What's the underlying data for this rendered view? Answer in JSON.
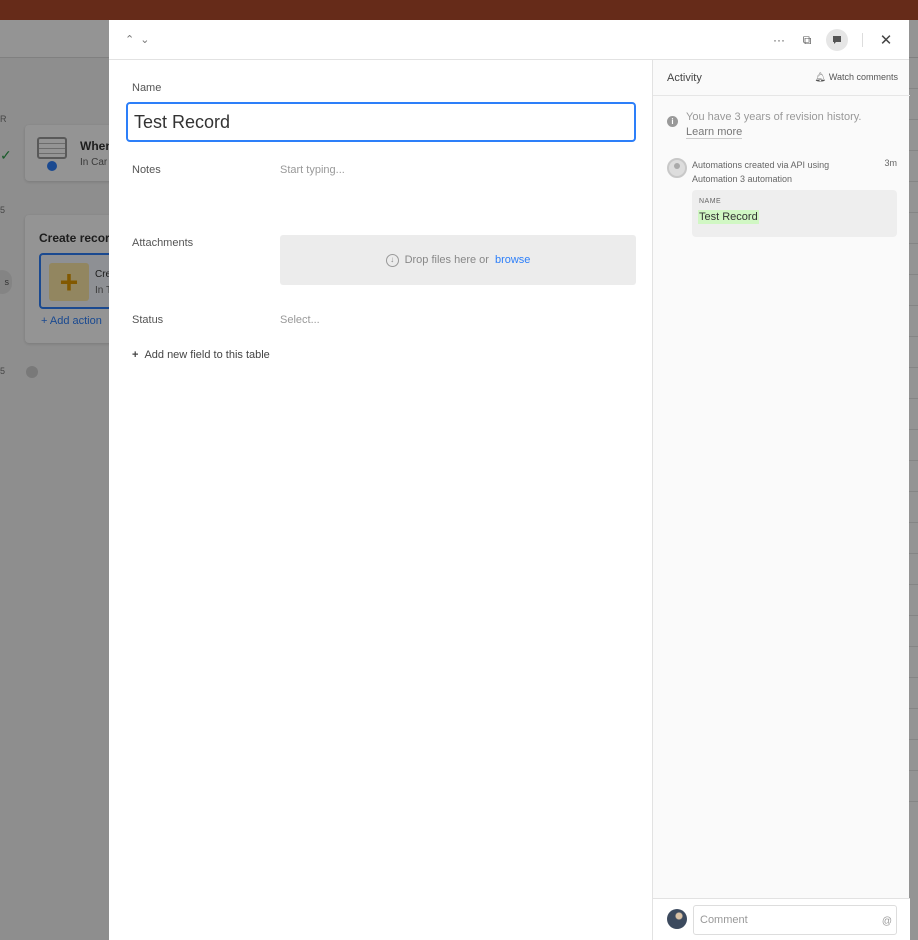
{
  "background": {
    "trigger_card": {
      "title": "When",
      "subtitle": "In Car"
    },
    "action_card": {
      "title": "Create record",
      "inner_title": "Cre",
      "inner_subtitle": "In T",
      "add_action": "Add action"
    },
    "side_badge": "s"
  },
  "header": {
    "prev_icon": "chevron-up-icon",
    "next_icon": "chevron-down-icon",
    "more_icon": "more-horizontal-icon",
    "expand_icon": "expand-icon",
    "comment_icon": "comment-icon",
    "close_icon": "close-icon"
  },
  "record": {
    "name_label": "Name",
    "name_value": "Test Record",
    "notes_label": "Notes",
    "notes_placeholder": "Start typing...",
    "attachments_label": "Attachments",
    "drop_text": "Drop files here or",
    "browse_text": "browse",
    "status_label": "Status",
    "status_placeholder": "Select...",
    "add_field_text": "Add new field to this table"
  },
  "activity": {
    "title": "Activity",
    "watch_label": "Watch comments",
    "revision_text": "You have 3 years of revision history.",
    "learn_more": "Learn more",
    "entry": {
      "author_line": "Automations created via API using Automation 3 automation",
      "time": "3m",
      "field_label": "NAME",
      "field_value": "Test Record"
    },
    "comment_placeholder": "Comment",
    "mention_symbol": "@"
  }
}
